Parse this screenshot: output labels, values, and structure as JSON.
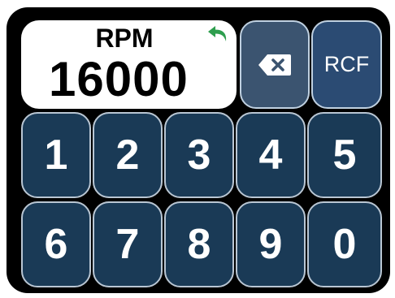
{
  "display": {
    "unit_label": "RPM",
    "value": "16000"
  },
  "buttons": {
    "undo_icon": "undo-arrow-icon",
    "backspace_icon": "backspace-icon",
    "rcf_label": "RCF"
  },
  "keypad": {
    "keys": [
      "1",
      "2",
      "3",
      "4",
      "5",
      "6",
      "7",
      "8",
      "9",
      "0"
    ]
  },
  "colors": {
    "frame": "#000000",
    "display_bg": "#ffffff",
    "key_bg": "#1a3a56",
    "backspace_bg": "#3b5470",
    "rcf_bg": "#2b4b73",
    "undo_icon": "#2e9e4e"
  }
}
